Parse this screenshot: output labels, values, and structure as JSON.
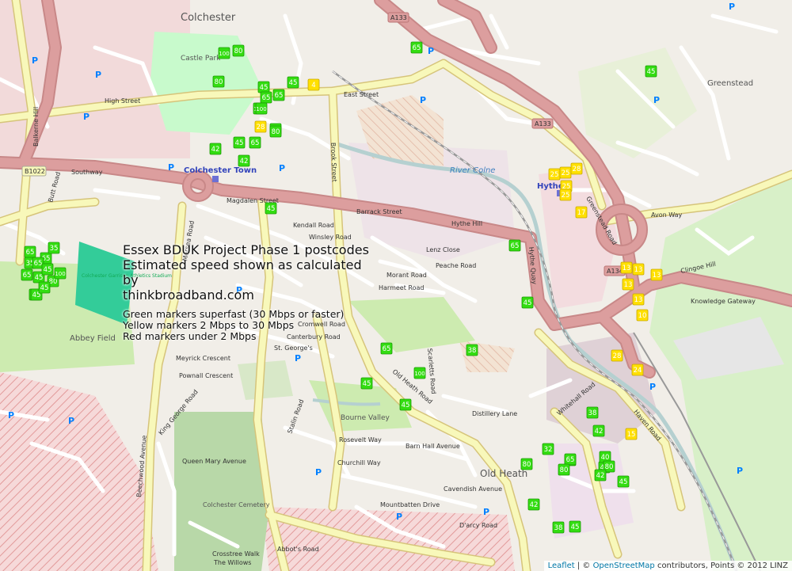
{
  "legend": {
    "title_line1": "Essex BDUK Project Phase 1 postcodes",
    "title_line2": "Estimated speed shown as calculated by",
    "title_line3": "thinkbroadband.com",
    "line_green": "Green markers superfast (30 Mbps or faster)",
    "line_yellow": "Yellow markers 2 Mbps to 30 Mbps",
    "line_red": "Red markers under 2 Mbps"
  },
  "attribution": {
    "leaflet": "Leaflet",
    "separator": " | © ",
    "osm": "OpenStreetMap",
    "rest": " contributors, Points © 2012 LINZ"
  },
  "colors": {
    "green_marker": "#33dd11",
    "yellow_marker": "#ffe000",
    "park": "#c8facc",
    "industrial": "#dfd1d6",
    "military_hatch": "#e8a0a0",
    "primary_road": "#dc9e9e",
    "secondary_road": "#f8f8ba",
    "water": "#b5d0d0",
    "stadium": "#33cc99"
  },
  "places": [
    {
      "name": "Colchester",
      "kind": "town"
    },
    {
      "name": "Colchester Town",
      "kind": "station"
    },
    {
      "name": "Hythe",
      "kind": "station"
    },
    {
      "name": "Old Heath",
      "kind": "district"
    },
    {
      "name": "Greenstead",
      "kind": "district"
    },
    {
      "name": "Abbey Field",
      "kind": "park"
    },
    {
      "name": "Castle Park",
      "kind": "park"
    },
    {
      "name": "Colchester Cemetery",
      "kind": "cemetery"
    },
    {
      "name": "Colchester Garrison Athletics Stadium",
      "kind": "stadium"
    },
    {
      "name": "Bourne Valley",
      "kind": "park"
    },
    {
      "name": "River Colne",
      "kind": "river"
    }
  ],
  "road_labels": [
    "Southway",
    "Magdalen Street",
    "Barrack Street",
    "Hythe Hill",
    "High Street",
    "East Street",
    "Old Heath Road",
    "Abbot's Road",
    "Mersea Road",
    "Brook Street",
    "Greenstead Road",
    "Clingoe Hill",
    "Avon Way",
    "Haven Road",
    "Knowledge Gateway",
    "Butt Road",
    "Balkerne Hill",
    "Hythe Quay",
    "Whitehall Road",
    "Distillery Lane",
    "Barn Hall Avenue",
    "Cavendish Avenue",
    "Canterbury Road",
    "St. George's",
    "Kendall Road",
    "Winsley Road",
    "Lenz Close",
    "Morant Road",
    "Harmeet Road",
    "Peache Road",
    "Cromwell Road",
    "Rosevelt Way",
    "Churchill Way",
    "Queen Mary Avenue",
    "King George Road",
    "Meyrick Crescent",
    "Pownall Crescent",
    "Crosstree Walk",
    "The Willows",
    "Beechwood Avenue",
    "Mountbatten Drive",
    "D'arcy Road",
    "Stalin Road",
    "Scarletts Road",
    "A133",
    "A134",
    "B1022"
  ],
  "markers": {
    "green": [
      "100",
      "80",
      "80",
      "45",
      "45",
      "65",
      "65",
      "100",
      "100",
      "65",
      "80",
      "80",
      "45",
      "42",
      "42",
      "65",
      "45",
      "65",
      "65",
      "35",
      "35",
      "65",
      "45",
      "45",
      "65",
      "80",
      "45",
      "45",
      "45",
      "100",
      "65",
      "65",
      "38",
      "45",
      "45",
      "100",
      "45",
      "65",
      "42",
      "32",
      "65",
      "80",
      "80",
      "45",
      "40",
      "80",
      "42",
      "45",
      "42",
      "38",
      "38",
      "45",
      "45"
    ],
    "yellow": [
      "4",
      "28",
      "25",
      "25",
      "28",
      "25",
      "25",
      "17",
      "13",
      "13",
      "13",
      "13",
      "13",
      "10",
      "28",
      "24",
      "15"
    ]
  }
}
